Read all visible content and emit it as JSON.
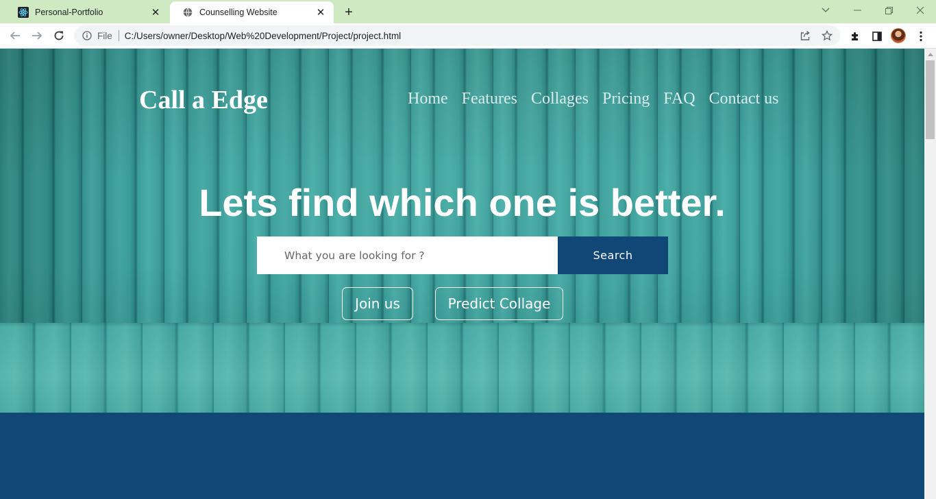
{
  "browser": {
    "tabs": [
      {
        "title": "Personal-Portfolio",
        "favicon": "react-icon",
        "active": false
      },
      {
        "title": "Counselling Website",
        "favicon": "globe-icon",
        "active": true
      }
    ],
    "address": {
      "scheme_label": "File",
      "url": "C:/Users/owner/Desktop/Web%20Development/Project/project.html"
    }
  },
  "site": {
    "brand": "Call a Edge",
    "nav": [
      "Home",
      "Features",
      "Collages",
      "Pricing",
      "FAQ",
      "Contact us"
    ],
    "headline": "Lets find which one is better.",
    "search": {
      "placeholder": "What you are looking for ?",
      "button": "Search"
    },
    "buttons": {
      "join": "Join us",
      "predict": "Predict Collage"
    }
  },
  "colors": {
    "tabstrip": "#cfe9c3",
    "brand_blue": "#104777",
    "hero_teal": "#3a9c98"
  }
}
